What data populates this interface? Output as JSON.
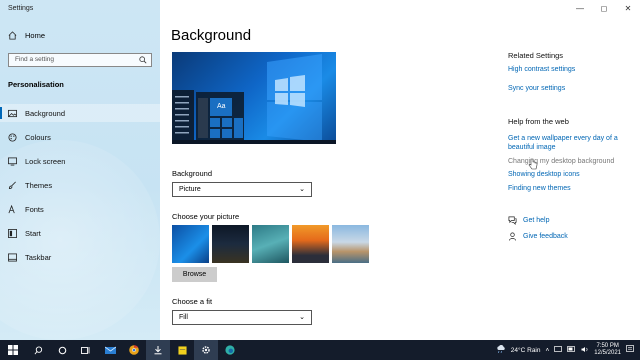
{
  "window": {
    "title": "Settings"
  },
  "sidebar": {
    "home_label": "Home",
    "search_placeholder": "Find a setting",
    "section_title": "Personalisation",
    "items": [
      {
        "label": "Background",
        "icon": "image-icon",
        "active": true
      },
      {
        "label": "Colours",
        "icon": "palette-icon"
      },
      {
        "label": "Lock screen",
        "icon": "lock-screen-icon"
      },
      {
        "label": "Themes",
        "icon": "brush-icon"
      },
      {
        "label": "Fonts",
        "icon": "font-icon"
      },
      {
        "label": "Start",
        "icon": "start-icon"
      },
      {
        "label": "Taskbar",
        "icon": "taskbar-icon"
      }
    ]
  },
  "main": {
    "title": "Background",
    "preview_tile_text": "Aa",
    "background_label": "Background",
    "background_value": "Picture",
    "choose_picture_label": "Choose your picture",
    "browse_label": "Browse",
    "fit_label": "Choose a fit",
    "fit_value": "Fill"
  },
  "related": {
    "title": "Related Settings",
    "links": [
      "High contrast settings",
      "Sync your settings"
    ]
  },
  "web_help": {
    "title": "Help from the web",
    "links": [
      "Get a new wallpaper every day of a beautiful image",
      "Changing my desktop background",
      "Showing desktop icons",
      "Finding new themes"
    ]
  },
  "help": {
    "get_help": "Get help",
    "give_feedback": "Give feedback"
  },
  "taskbar": {
    "weather": "24°C  Rain",
    "time": "7:50 PM",
    "date": "12/5/2021",
    "accent": "#2f3d52"
  },
  "colors": {
    "accent": "#0067b8",
    "link": "#0066b4",
    "sidebar_bg": "#cde6f4",
    "taskbar_bg": "#141c2b"
  }
}
